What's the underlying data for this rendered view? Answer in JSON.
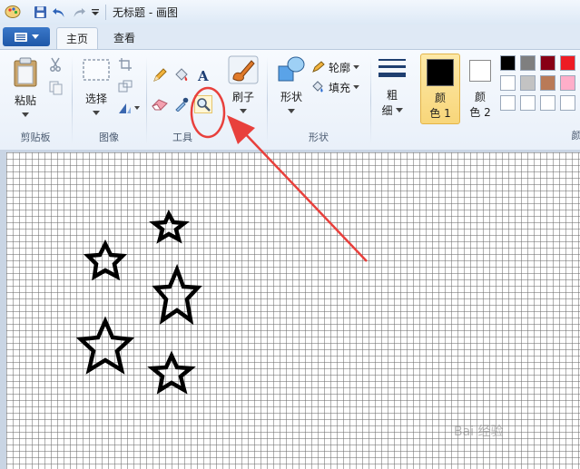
{
  "window": {
    "title": "无标题 - 画图"
  },
  "tabs": [
    {
      "label": "主页"
    },
    {
      "label": "查看"
    }
  ],
  "clipboard": {
    "paste_label": "粘贴",
    "group_label": "剪贴板"
  },
  "image": {
    "select_label": "选择",
    "group_label": "图像"
  },
  "tools": {
    "group_label": "工具"
  },
  "brushes": {
    "label": "刷子"
  },
  "shapes": {
    "shapes_label": "形状",
    "outline_label": "轮廓",
    "fill_label": "填充",
    "group_label": "形状"
  },
  "size": {
    "label_line1": "粗",
    "label_line2": "细"
  },
  "color1": {
    "line1": "颜",
    "line2": "色 1",
    "value": "#000000"
  },
  "color2": {
    "line1": "颜",
    "line2": "色 2",
    "value": "#ffffff"
  },
  "colors_group_label": "颜",
  "palette": [
    [
      "#000000",
      "#7f7f7f",
      "#880015",
      "#ed1c24"
    ],
    [
      "#ffffff",
      "#c3c3c3",
      "#b97a57",
      "#ffaec9"
    ],
    [
      "#ffffff",
      "#ffffff",
      "#ffffff",
      "#ffffff"
    ]
  ],
  "annotation": {
    "color": "#e8403c"
  },
  "watermark": {
    "text": "Bai 经验"
  }
}
